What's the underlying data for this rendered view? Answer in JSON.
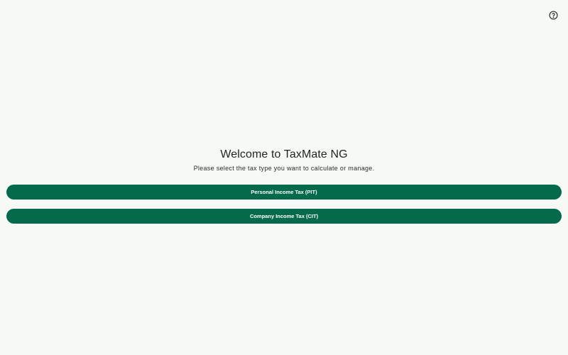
{
  "header": {
    "help_icon": "help-circle-icon"
  },
  "welcome": {
    "title": "Welcome to TaxMate NG",
    "subtitle": "Please select the tax type you want to calculate or manage."
  },
  "options": {
    "pit_label": "Personal Income Tax (PIT)",
    "cit_label": "Company Income Tax (CIT)"
  },
  "colors": {
    "background": "#f6f9f6",
    "primary": "#046a4b",
    "button_text": "#ffffff"
  }
}
